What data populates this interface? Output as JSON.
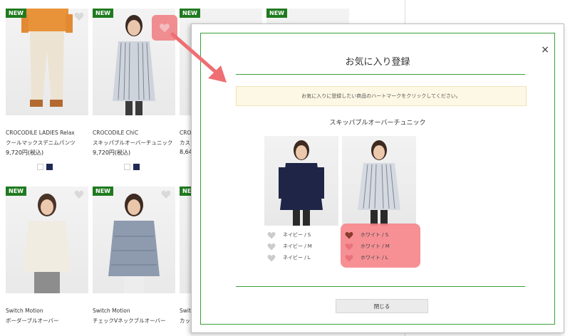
{
  "products": [
    {
      "badge": "NEW",
      "brand": "CROCODILE LADIES Relax",
      "name": "クールマックスデニムパンツ",
      "price": "9,720円(税込)"
    },
    {
      "badge": "NEW",
      "brand": "CROCODILE ChiC",
      "name": "スキッパブルオーバーチュニック",
      "price": "9,720円(税込)"
    },
    {
      "badge": "NEW",
      "brand": "CROCO",
      "name": "カスリ",
      "price": "8,64"
    },
    {
      "badge": "NEW"
    },
    {
      "badge": "NEW",
      "brand": "Switch Motion",
      "name": "ボーダーブルオーバー"
    },
    {
      "badge": "NEW",
      "brand": "Switch Motion",
      "name": "チェックVネックブルオーバー"
    },
    {
      "badge": "NEW",
      "brand": "Switc",
      "name": "カット"
    }
  ],
  "modal": {
    "close_icon": "×",
    "title": "お気に入り登録",
    "notice": "お気に入りに登録したい商品のハートマークをクリックしてください。",
    "product_name": "スキッパブルオーバーチュニック",
    "navy_sizes": [
      "ネイビー / S",
      "ネイビー / M",
      "ネイビー / L"
    ],
    "white_sizes": [
      "ホワイト / S",
      "ホワイト / M",
      "ホワイト / L"
    ],
    "close_button": "閉じる"
  },
  "colors": {
    "badge": "#1f7a1f",
    "modal_border": "#3aa03a",
    "highlight": "#f5848a",
    "arrow": "#ee6e73",
    "heart_gray": "#cccccc",
    "heart_selected": "#8a3b2b"
  }
}
